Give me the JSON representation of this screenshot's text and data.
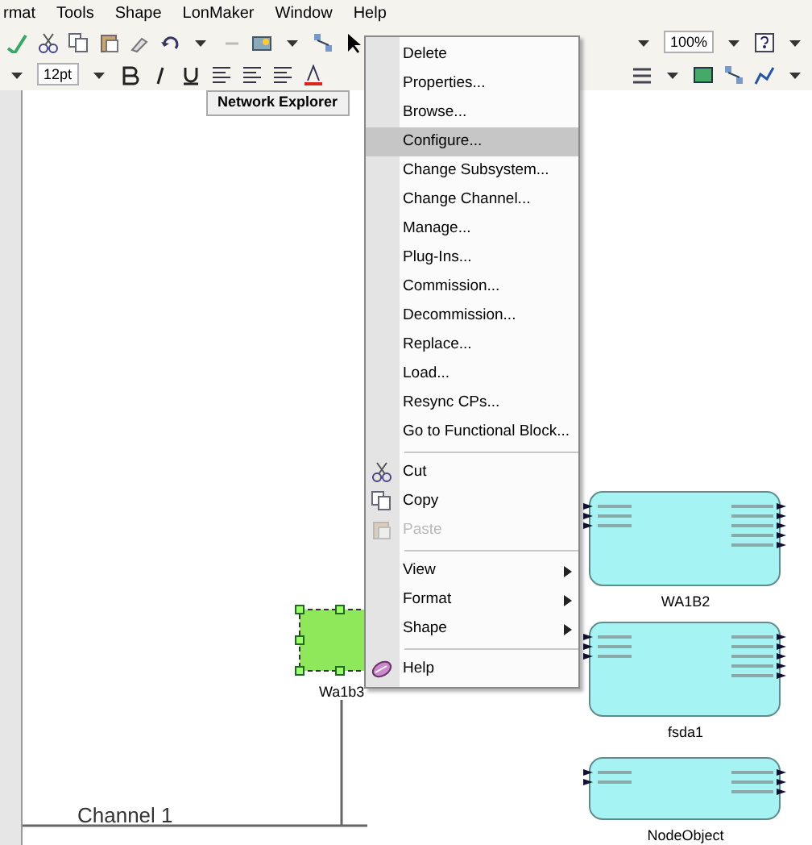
{
  "menu_bar": [
    {
      "label": "rmat"
    },
    {
      "label": "Tools"
    },
    {
      "label": "Shape"
    },
    {
      "label": "LonMaker"
    },
    {
      "label": "Window"
    },
    {
      "label": "Help"
    }
  ],
  "toolbar": {
    "zoom": "100%",
    "font_size": "12pt"
  },
  "stencil_tab": "Network Explorer",
  "context_menu": [
    {
      "kind": "item",
      "label": "Delete",
      "selected": false,
      "disabled": false,
      "submenu": false
    },
    {
      "kind": "item",
      "label": "Properties...",
      "selected": false,
      "disabled": false,
      "submenu": false
    },
    {
      "kind": "item",
      "label": "Browse...",
      "selected": false,
      "disabled": false,
      "submenu": false
    },
    {
      "kind": "item",
      "label": "Configure...",
      "selected": true,
      "disabled": false,
      "submenu": false
    },
    {
      "kind": "item",
      "label": "Change Subsystem...",
      "selected": false,
      "disabled": false,
      "submenu": false
    },
    {
      "kind": "item",
      "label": "Change Channel...",
      "selected": false,
      "disabled": false,
      "submenu": false
    },
    {
      "kind": "item",
      "label": "Manage...",
      "selected": false,
      "disabled": false,
      "submenu": false
    },
    {
      "kind": "item",
      "label": "Plug-Ins...",
      "selected": false,
      "disabled": false,
      "submenu": false
    },
    {
      "kind": "item",
      "label": "Commission...",
      "selected": false,
      "disabled": false,
      "submenu": false
    },
    {
      "kind": "item",
      "label": "Decommission...",
      "selected": false,
      "disabled": false,
      "submenu": false
    },
    {
      "kind": "item",
      "label": "Replace...",
      "selected": false,
      "disabled": false,
      "submenu": false
    },
    {
      "kind": "item",
      "label": "Load...",
      "selected": false,
      "disabled": false,
      "submenu": false
    },
    {
      "kind": "item",
      "label": "Resync CPs...",
      "selected": false,
      "disabled": false,
      "submenu": false
    },
    {
      "kind": "item",
      "label": "Go to Functional Block...",
      "selected": false,
      "disabled": false,
      "submenu": false
    },
    {
      "kind": "separator"
    },
    {
      "kind": "item",
      "label": "Cut",
      "selected": false,
      "disabled": false,
      "submenu": false
    },
    {
      "kind": "item",
      "label": "Copy",
      "selected": false,
      "disabled": false,
      "submenu": false
    },
    {
      "kind": "item",
      "label": "Paste",
      "selected": false,
      "disabled": true,
      "submenu": false
    },
    {
      "kind": "separator"
    },
    {
      "kind": "item",
      "label": "View",
      "selected": false,
      "disabled": false,
      "submenu": true
    },
    {
      "kind": "item",
      "label": "Format",
      "selected": false,
      "disabled": false,
      "submenu": true
    },
    {
      "kind": "item",
      "label": "Shape",
      "selected": false,
      "disabled": false,
      "submenu": true
    },
    {
      "kind": "separator"
    },
    {
      "kind": "item",
      "label": "Help",
      "selected": false,
      "disabled": false,
      "submenu": false
    }
  ],
  "device": {
    "label": "Wa1b3",
    "selected": true
  },
  "blocks": [
    {
      "label": "WA1B2"
    },
    {
      "label": "fsda1"
    },
    {
      "label": "NodeObject"
    }
  ],
  "channel": {
    "label": "Channel 1"
  }
}
